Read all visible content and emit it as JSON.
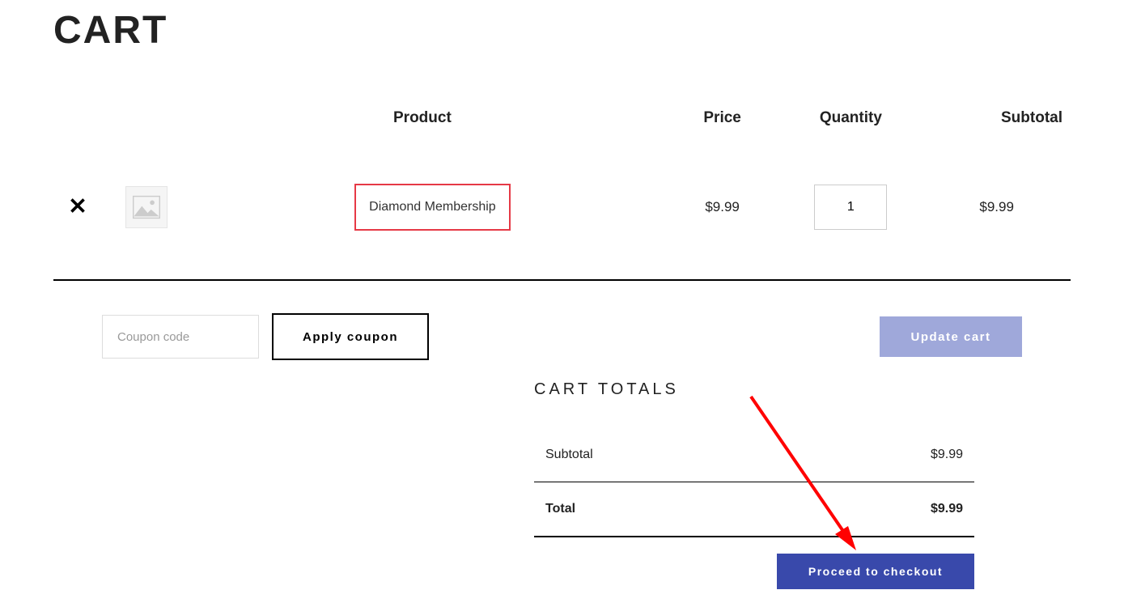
{
  "page": {
    "title": "CART"
  },
  "table": {
    "headers": {
      "product": "Product",
      "price": "Price",
      "quantity": "Quantity",
      "subtotal": "Subtotal"
    },
    "items": [
      {
        "name": "Diamond Membership",
        "price": "$9.99",
        "quantity": "1",
        "subtotal": "$9.99"
      }
    ]
  },
  "coupon": {
    "placeholder": "Coupon code",
    "apply_label": "Apply coupon"
  },
  "update_label": "Update cart",
  "totals": {
    "title": "CART TOTALS",
    "subtotal_label": "Subtotal",
    "subtotal_value": "$9.99",
    "total_label": "Total",
    "total_value": "$9.99"
  },
  "checkout_label": "Proceed to checkout"
}
